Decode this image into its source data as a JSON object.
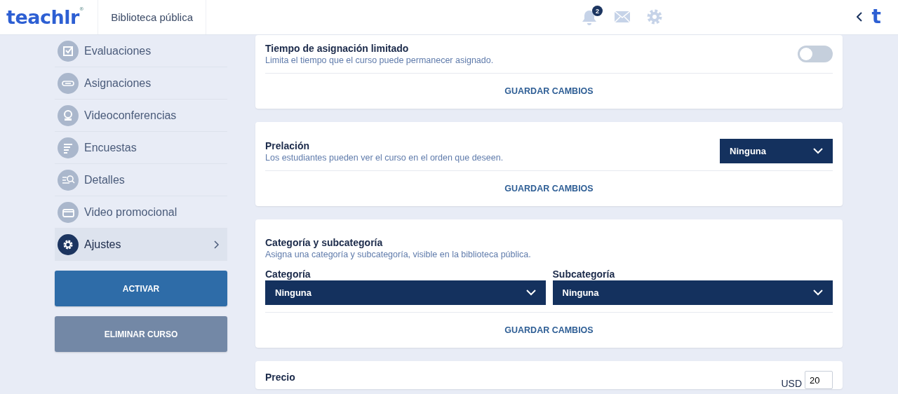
{
  "header": {
    "logo": "teachlr$^{®}$",
    "section": "Biblioteca pública",
    "notifications": "2",
    "app_letter": "t"
  },
  "sidebar": {
    "items": [
      {
        "label": "Evaluaciones",
        "kind": "check",
        "selected": false
      },
      {
        "label": "Asignaciones",
        "kind": "link",
        "selected": false
      },
      {
        "label": "Videoconferencias",
        "kind": "webcam",
        "selected": false
      },
      {
        "label": "Encuestas",
        "kind": "lines",
        "selected": false
      },
      {
        "label": "Detalles",
        "kind": "search",
        "selected": false
      },
      {
        "label": "Video promocional",
        "kind": "clapper",
        "selected": false
      },
      {
        "label": "Ajustes",
        "kind": "gear",
        "selected": true
      }
    ],
    "buttons": [
      {
        "label": "ACTIVAR",
        "kind": "primary"
      },
      {
        "label": "ELIMINAR CURSO",
        "kind": "secondary"
      }
    ]
  },
  "sections": [
    {
      "kind": "toggle",
      "title": "Tiempo de asignación limitado",
      "description": "Limita el tiempo que el curso puede permanecer asignado.",
      "on": false,
      "action": "GUARDAR CAMBIOS"
    },
    {
      "kind": "select",
      "title": "Prelación",
      "description": "Los estudiantes pueden ver el curso en el orden que deseen.",
      "value": "Ninguna",
      "action": "GUARDAR CAMBIOS"
    },
    {
      "kind": "pair",
      "title": "Categoría y subcategoría",
      "description": "Asigna una categoría y subcategoría, visible en la biblioteca pública.",
      "fields": [
        {
          "label": "Categoría",
          "value": "Ninguna"
        },
        {
          "label": "Subcategoría",
          "value": "Ninguna"
        }
      ],
      "action": "GUARDAR CAMBIOS"
    },
    {
      "kind": "price",
      "title": "Precio",
      "currency": "USD",
      "value": "20"
    }
  ]
}
